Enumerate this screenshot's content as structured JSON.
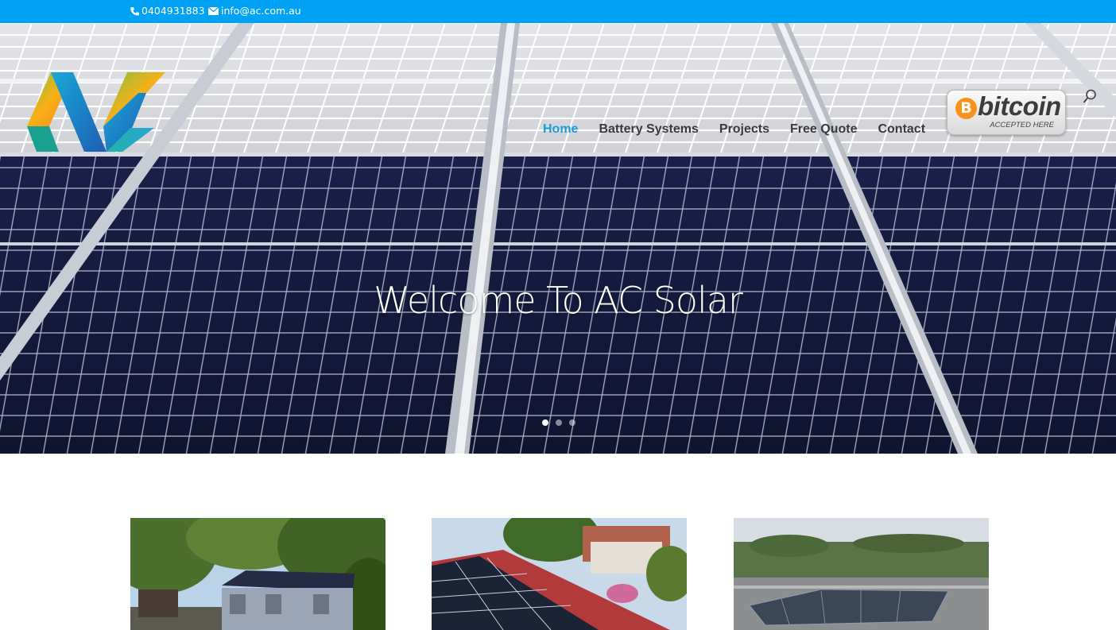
{
  "topbar": {
    "phone": "0404931883",
    "email": "info@ac.com.au",
    "phone_icon": "phone-icon",
    "email_icon": "envelope-icon",
    "background": "#00a2f5"
  },
  "header": {
    "logo_text": "AC",
    "nav": [
      {
        "label": "Home",
        "active": true
      },
      {
        "label": "Battery Systems",
        "active": false
      },
      {
        "label": "Projects",
        "active": false
      },
      {
        "label": "Free Quote",
        "active": false
      },
      {
        "label": "Contact",
        "active": false
      }
    ],
    "active_color": "#1a9bdc",
    "bitcoin_badge": {
      "symbol": "B",
      "word": "bitcoin",
      "tagline": "ACCEPTED HERE"
    },
    "search_icon": "search-icon"
  },
  "hero": {
    "title": "Welcome To AC Solar",
    "slides": 3,
    "active_slide": 1
  },
  "projects": [
    {
      "image": "house-with-solar-panels-among-trees"
    },
    {
      "image": "solar-panels-on-red-tile-roof"
    },
    {
      "image": "solar-array-on-flat-commercial-roof"
    }
  ]
}
